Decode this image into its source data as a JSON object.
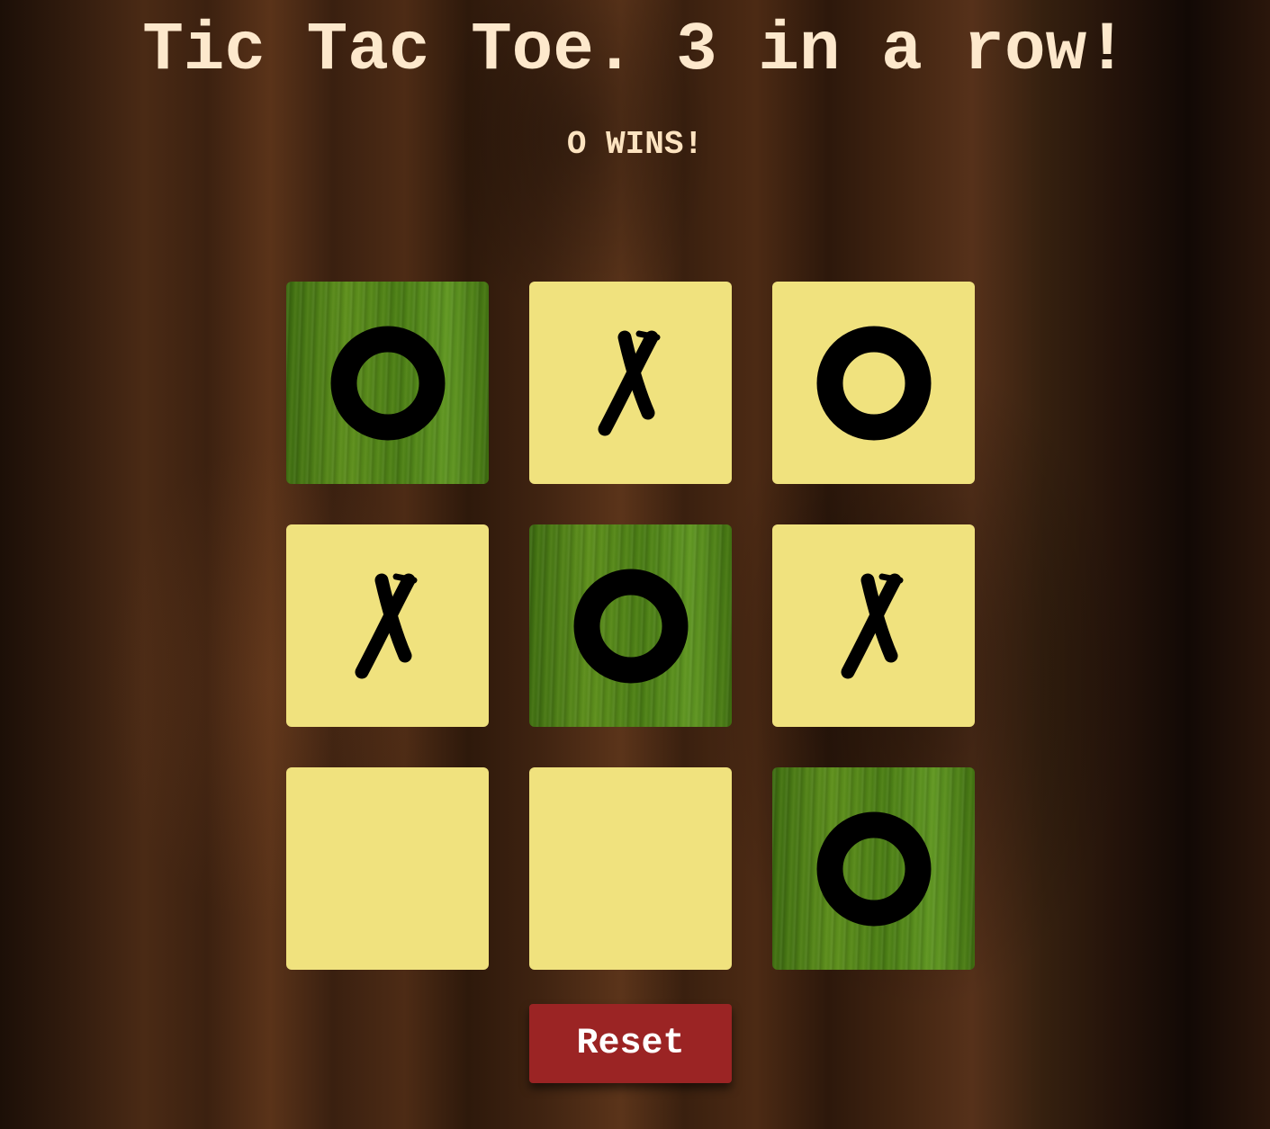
{
  "header": {
    "title": "Tic Tac Toe. 3 in a row!"
  },
  "status": {
    "text": "O WINS!"
  },
  "board": {
    "cells": [
      {
        "mark": "O",
        "winning": true
      },
      {
        "mark": "X",
        "winning": false
      },
      {
        "mark": "O",
        "winning": false
      },
      {
        "mark": "X",
        "winning": false
      },
      {
        "mark": "O",
        "winning": true
      },
      {
        "mark": "X",
        "winning": false
      },
      {
        "mark": "",
        "winning": false
      },
      {
        "mark": "",
        "winning": false
      },
      {
        "mark": "O",
        "winning": true
      }
    ]
  },
  "controls": {
    "reset_label": "Reset"
  },
  "colors": {
    "tile": "#f0e27e",
    "winning_tile": "#4a7a14",
    "mark": "#000000",
    "text": "#fde8cc",
    "reset_button": "#9b2424"
  },
  "icons": {
    "o_mark": "o-mark-icon",
    "x_mark": "x-mark-icon"
  }
}
